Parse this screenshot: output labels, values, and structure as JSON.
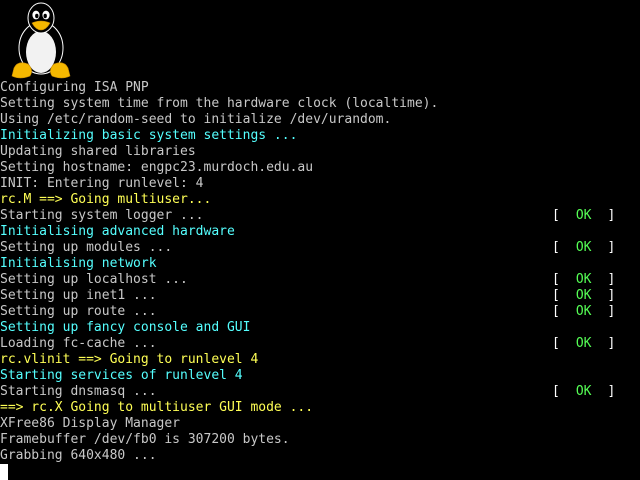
{
  "colors": {
    "background": "#000000",
    "plain": "#c8c8c8",
    "section": "#55ffff",
    "runlevel": "#ffff55",
    "ok": "#55ff55",
    "bracket": "#ffffff"
  },
  "logo_icon": "tux-penguin-icon",
  "lines": [
    {
      "text": "Configuring ISA PNP",
      "kind": "plain"
    },
    {
      "text": "Setting system time from the hardware clock (localtime).",
      "kind": "plain"
    },
    {
      "text": "Using /etc/random-seed to initialize /dev/urandom.",
      "kind": "plain"
    },
    {
      "text": "Initializing basic system settings ...",
      "kind": "section"
    },
    {
      "text": "Updating shared libraries",
      "kind": "plain"
    },
    {
      "text": "Setting hostname: engpc23.murdoch.edu.au",
      "kind": "plain"
    },
    {
      "text": "INIT: Entering runlevel: 4",
      "kind": "plain"
    },
    {
      "text": "rc.M ==> Going multiuser...",
      "kind": "runlevel"
    },
    {
      "text": "Starting system logger ...",
      "kind": "plain",
      "status": "OK"
    },
    {
      "text": "Initialising advanced hardware",
      "kind": "section"
    },
    {
      "text": "Setting up modules ...",
      "kind": "plain",
      "status": "OK"
    },
    {
      "text": "Initialising network",
      "kind": "section"
    },
    {
      "text": "Setting up localhost ...",
      "kind": "plain",
      "status": "OK"
    },
    {
      "text": "Setting up inet1 ...",
      "kind": "plain",
      "status": "OK"
    },
    {
      "text": "Setting up route ...",
      "kind": "plain",
      "status": "OK"
    },
    {
      "text": "Setting up fancy console and GUI",
      "kind": "section"
    },
    {
      "text": "Loading fc-cache ...",
      "kind": "plain",
      "status": "OK"
    },
    {
      "text": "rc.vlinit ==> Going to runlevel 4",
      "kind": "runlevel"
    },
    {
      "text": "Starting services of runlevel 4",
      "kind": "section"
    },
    {
      "text": "Starting dnsmasq ...",
      "kind": "plain",
      "status": "OK"
    },
    {
      "text": "==> rc.X Going to multiuser GUI mode ...",
      "kind": "runlevel"
    },
    {
      "text": "XFree86 Display Manager",
      "kind": "plain"
    },
    {
      "text": "Framebuffer /dev/fb0 is 307200 bytes.",
      "kind": "plain"
    },
    {
      "text": "Grabbing 640x480 ...",
      "kind": "plain"
    }
  ],
  "bracket_open": "[",
  "bracket_close": "]"
}
